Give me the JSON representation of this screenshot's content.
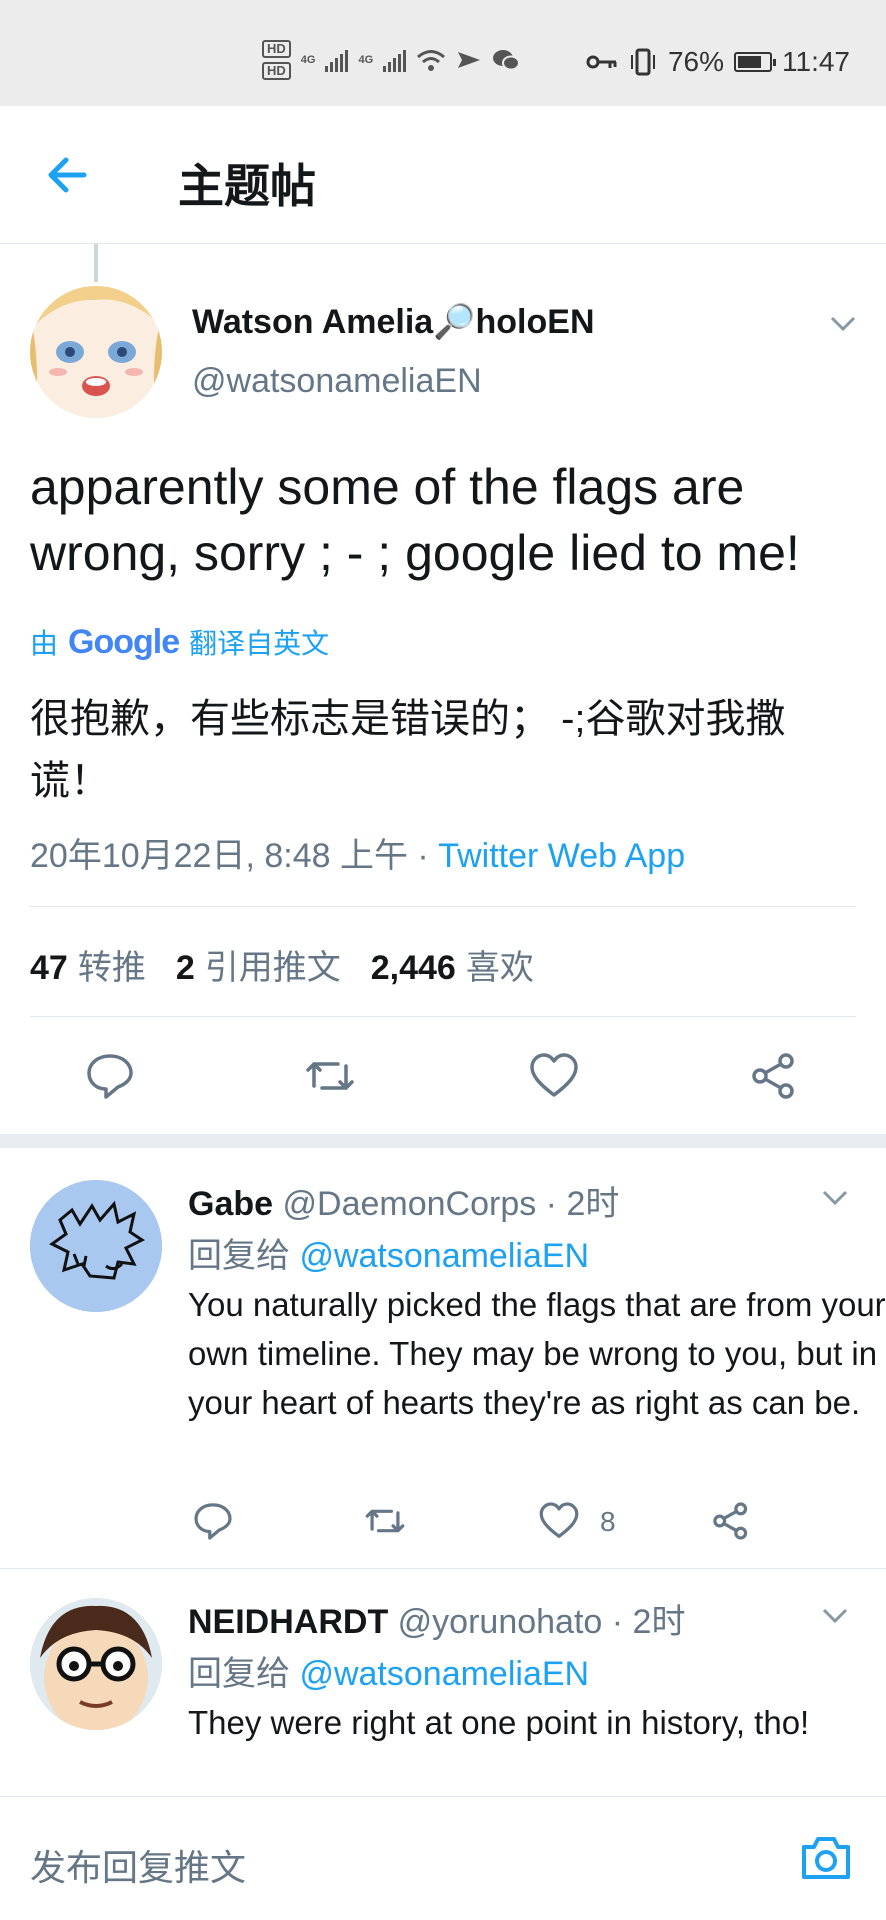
{
  "status_bar": {
    "hd1": "HD",
    "hd2": "HD",
    "net1": "4G",
    "net2": "4G",
    "battery_pct": "76%",
    "time": "11:47",
    "battery_level": 0.76
  },
  "header": {
    "title": "主题帖",
    "back_icon": "arrow-left-icon"
  },
  "tweet": {
    "name": "Watson Amelia🔎holoEN",
    "handle": "@watsonameliaEN",
    "text": "apparently some of the flags are wrong, sorry ; - ; google lied to me!",
    "translate_prefix": "由",
    "translate_brand": "Google",
    "translate_suffix": "翻译自英文",
    "translated_text": "很抱歉，有些标志是错误的；  -;谷歌对我撒谎！",
    "timestamp": "20年10月22日, 8:48 上午 · ",
    "source": "Twitter Web App",
    "stats": {
      "retweets_count": "47",
      "retweets_label": "转推",
      "quotes_count": "2",
      "quotes_label": "引用推文",
      "likes_count": "2,446",
      "likes_label": "喜欢"
    }
  },
  "replies": [
    {
      "name": "Gabe",
      "handle": "@DaemonCorps",
      "time": " · 2时",
      "reply_label": "回复给 ",
      "reply_to": "@watsonameliaEN",
      "text": "You naturally picked the flags that are from your own timeline. They may be wrong to you, but in your heart of hearts they're as right as can be.",
      "likes": "8"
    },
    {
      "name": "NEIDHARDT",
      "handle": "@yorunohato",
      "time": " · 2时",
      "reply_label": "回复给 ",
      "reply_to": "@watsonameliaEN",
      "text": "They were right at one point in history, tho!"
    }
  ],
  "compose": {
    "placeholder": "发布回复推文",
    "camera_icon": "camera-icon"
  },
  "colors": {
    "accent": "#1da1f2",
    "text": "#14171a",
    "secondary": "#657786"
  }
}
